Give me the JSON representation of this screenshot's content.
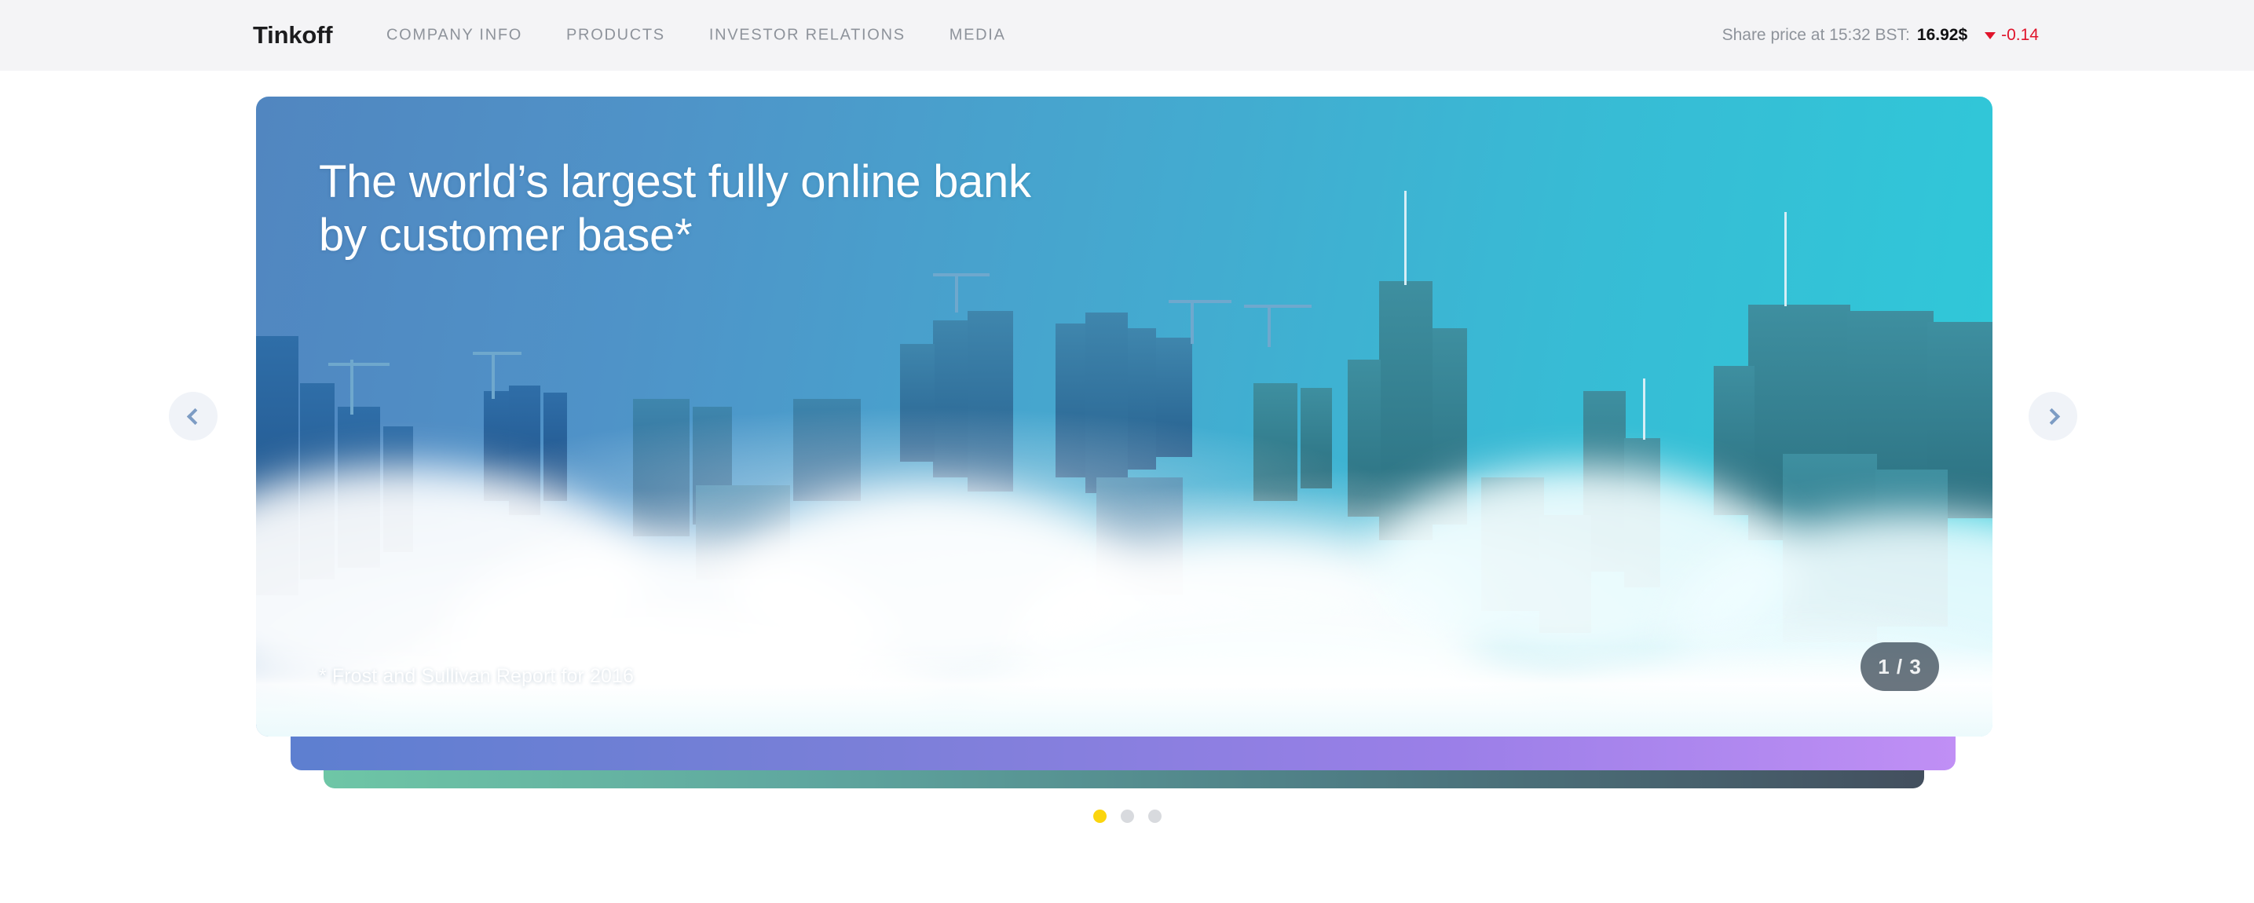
{
  "header": {
    "logo": "Tinkoff",
    "nav": [
      {
        "label": "COMPANY INFO"
      },
      {
        "label": "PRODUCTS"
      },
      {
        "label": "INVESTOR RELATIONS"
      },
      {
        "label": "MEDIA"
      }
    ],
    "share_price": {
      "label": "Share price at 15:32 BST:",
      "value": "16.92$",
      "delta": "-0.14",
      "direction": "down",
      "delta_color": "#e0142b"
    }
  },
  "hero": {
    "title_line_1": "The world’s largest fully online bank",
    "title_line_2": "by customer base*",
    "footnote": "* Frost and Sullivan Report for 2016",
    "counter": "1 / 3",
    "gradient_from": "#5186c0",
    "gradient_to": "#2fc9d9"
  },
  "carousel": {
    "prev_label": "‹",
    "next_label": "›",
    "current_slide": 1,
    "total_slides": 3,
    "active_dot_color": "#fbd50e",
    "inactive_dot_color": "#d8dade",
    "stacked_cards": [
      {
        "name": "purple-card",
        "from": "#5d7fd0",
        "to": "#c08ff5"
      },
      {
        "name": "teal-slate-card",
        "from": "#6ec6a6",
        "to": "#434f5e"
      }
    ]
  }
}
